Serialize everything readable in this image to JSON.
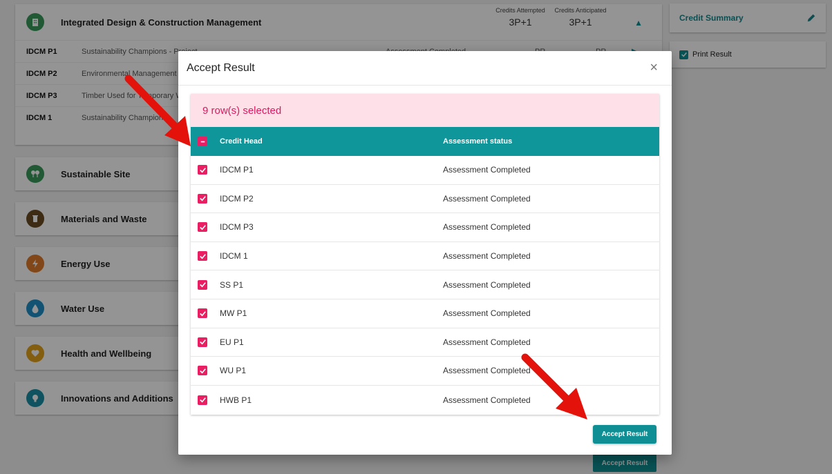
{
  "main": {
    "first_category": {
      "title": "Integrated Design & Construction Management",
      "credits_attempted_label": "Credits Attempted",
      "credits_attempted_value": "3P+1",
      "credits_anticipated_label": "Credits Anticipated",
      "credits_anticipated_value": "3P+1",
      "rows": [
        {
          "code": "IDCM P1",
          "name": "Sustainability Champions - Project",
          "status": "Assessment Completed",
          "attempted": "PR",
          "anticipated": "PR"
        },
        {
          "code": "IDCM P2",
          "name": "Environmental Management Pl"
        },
        {
          "code": "IDCM P3",
          "name": "Timber Used for Temporary Wo"
        },
        {
          "code": "IDCM 1",
          "name": "Sustainability Champions -"
        }
      ]
    },
    "categories": [
      {
        "title": "Sustainable Site",
        "color": "#3a9a5c"
      },
      {
        "title": "Materials and Waste",
        "color": "#6b4a23"
      },
      {
        "title": "Energy Use",
        "color": "#e07b2a"
      },
      {
        "title": "Water Use",
        "color": "#1f8fc8"
      },
      {
        "title": "Health and Wellbeing",
        "color": "#e3a21a"
      },
      {
        "title": "Innovations and Additions",
        "color": "#1a8fa6"
      }
    ],
    "background_accept_label": "Accept Result"
  },
  "side": {
    "summary_title": "Credit Summary",
    "print_result_label": "Print Result"
  },
  "modal": {
    "title": "Accept Result",
    "selected_text": "9 row(s) selected",
    "col_credit_head": "Credit Head",
    "col_assessment_status": "Assessment status",
    "rows": [
      {
        "credit": "IDCM P1",
        "status": "Assessment Completed"
      },
      {
        "credit": "IDCM P2",
        "status": "Assessment Completed"
      },
      {
        "credit": "IDCM P3",
        "status": "Assessment Completed"
      },
      {
        "credit": "IDCM 1",
        "status": "Assessment Completed"
      },
      {
        "credit": "SS P1",
        "status": "Assessment Completed"
      },
      {
        "credit": "MW P1",
        "status": "Assessment Completed"
      },
      {
        "credit": "EU P1",
        "status": "Assessment Completed"
      },
      {
        "credit": "WU P1",
        "status": "Assessment Completed"
      },
      {
        "credit": "HWB P1",
        "status": "Assessment Completed"
      }
    ],
    "accept_label": "Accept Result"
  },
  "colors": {
    "teal": "#0f8f93",
    "pink": "#e91e63",
    "selection_bg": "#fde0e8",
    "arrow": "#e3120b"
  }
}
